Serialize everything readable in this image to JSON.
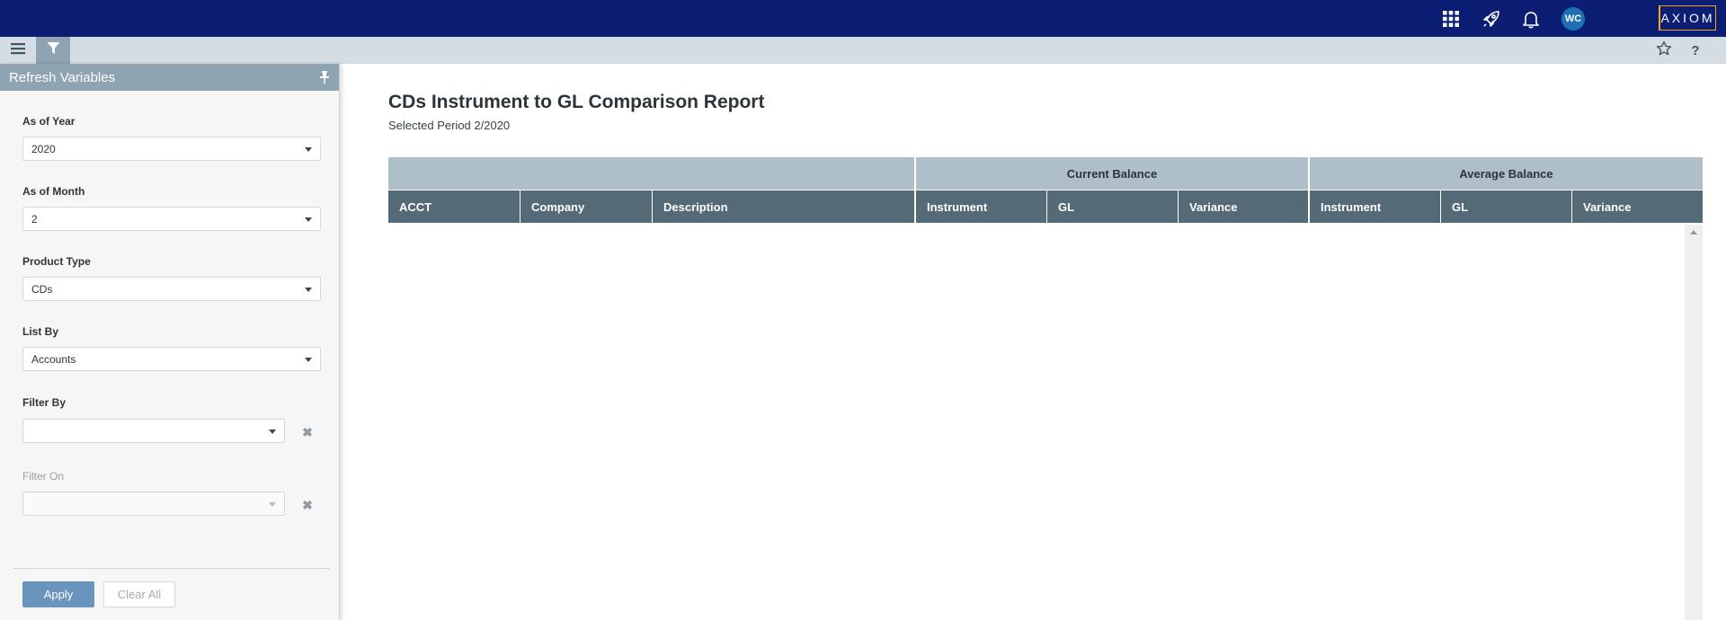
{
  "topbar": {
    "icons": [
      "apps-grid-icon",
      "rocket-icon",
      "bell-icon"
    ],
    "avatar_initials": "WC",
    "logo_text": "AXIOM"
  },
  "toolbar": {
    "left_icons": [
      "menu-icon",
      "filter-icon"
    ],
    "right_icons": [
      "star-icon",
      "help-icon"
    ],
    "help_glyph": "?"
  },
  "sidebar": {
    "title": "Refresh Variables",
    "fields": {
      "as_of_year": {
        "label": "As of Year",
        "value": "2020"
      },
      "as_of_month": {
        "label": "As of Month",
        "value": "2"
      },
      "product_type": {
        "label": "Product Type",
        "value": "CDs"
      },
      "list_by": {
        "label": "List By",
        "value": "Accounts"
      },
      "filter_by": {
        "label": "Filter By",
        "value": ""
      },
      "filter_on": {
        "label": "Filter On",
        "value": ""
      }
    },
    "clear_glyph": "✖",
    "apply_label": "Apply",
    "clear_all_label": "Clear All"
  },
  "report": {
    "title": "CDs Instrument to GL Comparison Report",
    "subtitle": "Selected Period 2/2020",
    "group_headers": {
      "current": "Current Balance",
      "average": "Average Balance"
    },
    "columns": [
      "ACCT",
      "Company",
      "Description",
      "Instrument",
      "GL",
      "Variance",
      "Instrument",
      "GL",
      "Variance"
    ]
  },
  "colors": {
    "topbar": "#0b1e73",
    "logo_border": "#f0a720",
    "column_header": "#546a77",
    "group_header": "#aebfc9",
    "apply_button": "#6a94bd"
  }
}
